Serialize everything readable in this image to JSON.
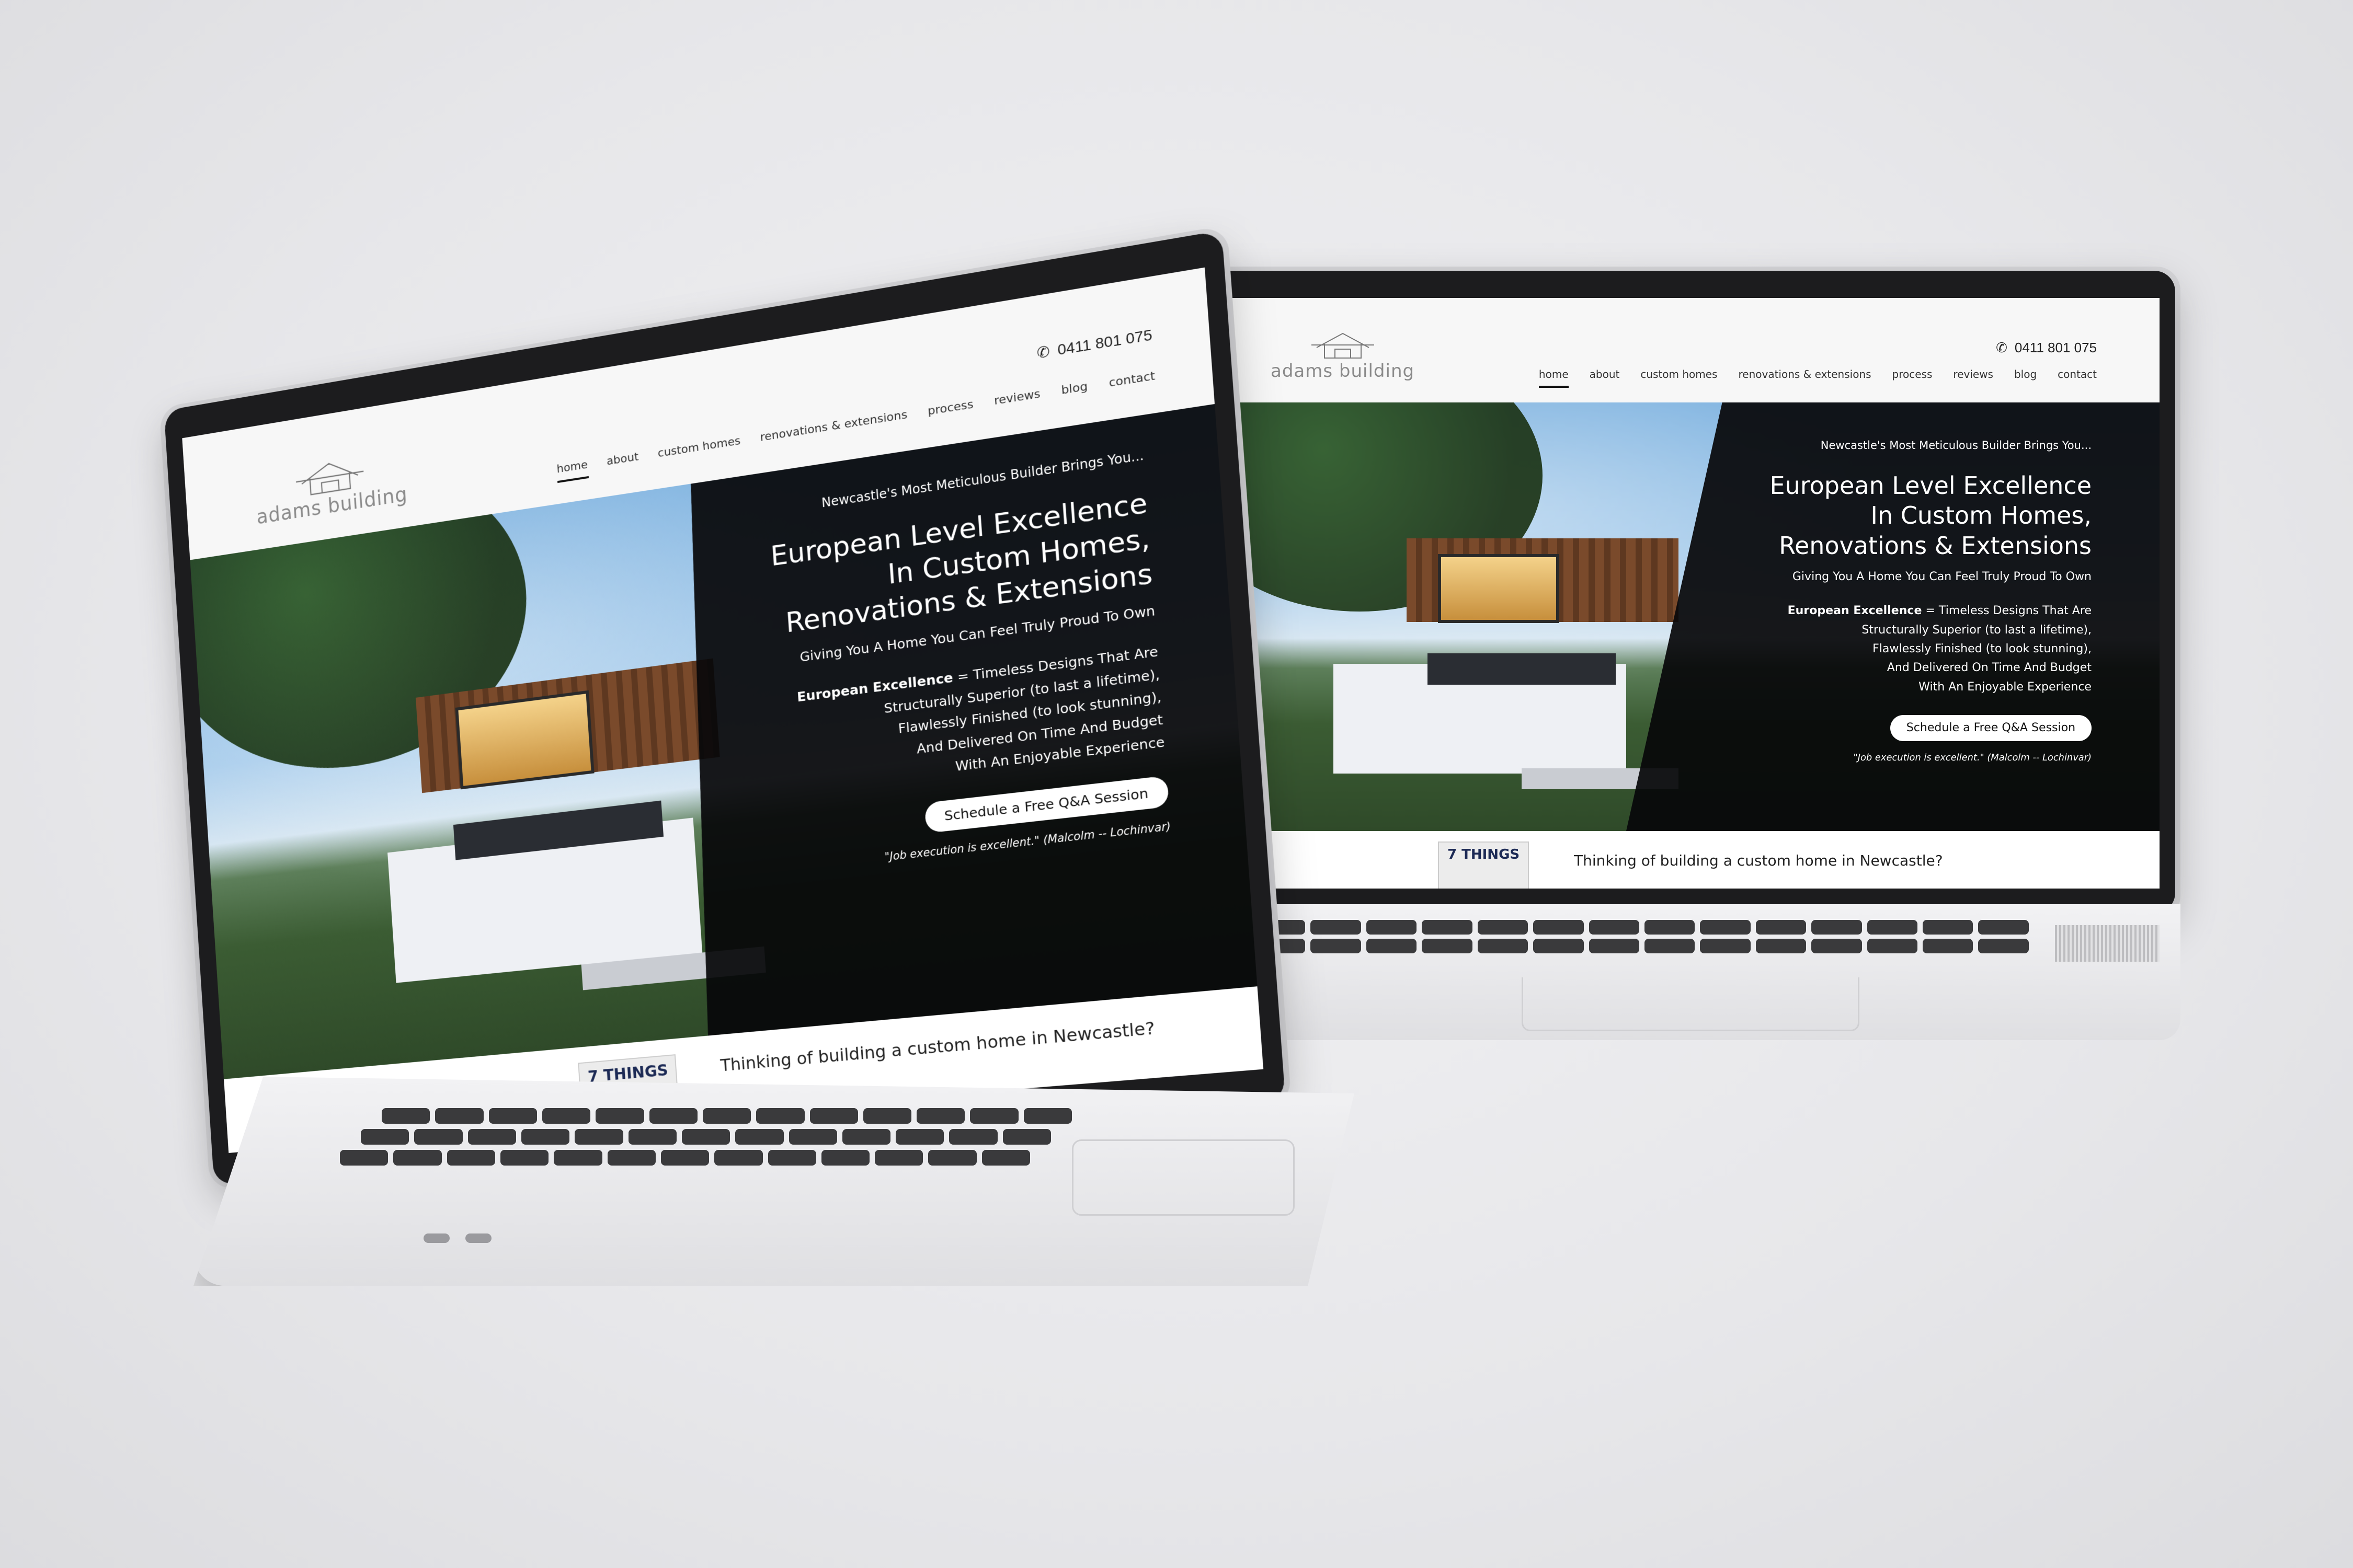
{
  "site": {
    "logo": {
      "text": "adams building",
      "icon": "house-outline-icon"
    },
    "phone": {
      "icon": "phone-icon",
      "number": "0411 801 075"
    },
    "nav": [
      {
        "label": "home",
        "active": true
      },
      {
        "label": "about",
        "active": false
      },
      {
        "label": "custom homes",
        "active": false
      },
      {
        "label": "renovations & extensions",
        "active": false
      },
      {
        "label": "process",
        "active": false
      },
      {
        "label": "reviews",
        "active": false
      },
      {
        "label": "blog",
        "active": false
      },
      {
        "label": "contact",
        "active": false
      }
    ],
    "hero": {
      "kicker": "Newcastle's Most Meticulous Builder Brings You...",
      "title_line1": "European Level Excellence",
      "title_line2": "In Custom Homes,",
      "title_line3": "Renovations & Extensions",
      "subtitle": "Giving You A Home You Can Feel Truly Proud To Own",
      "body_bold": "European Excellence",
      "body_line1": " = Timeless Designs That Are",
      "body_line2": "Structurally Superior (to last a lifetime),",
      "body_line3": "Flawlessly Finished (to look stunning),",
      "body_line4": "And Delivered On Time And Budget",
      "body_line5": "With An Enjoyable Experience",
      "cta": "Schedule a Free Q&A Session",
      "quote": "\"Job execution is excellent.\" (Malcolm -- Lochinvar)"
    },
    "below": {
      "book_title": "7 THINGS",
      "teaser": "Thinking of building a custom home in Newcastle?"
    }
  },
  "colors": {
    "panel": "#0a0a0c",
    "background": "#e7e7ea",
    "laptop_body": "#dcdcdf",
    "bezel": "#1c1c1e"
  }
}
